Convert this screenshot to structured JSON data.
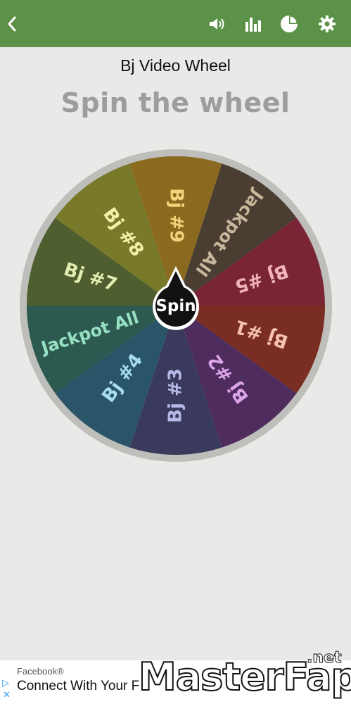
{
  "header": {
    "back_icon": "back-arrow-icon",
    "actions": [
      "sound-icon",
      "stats-icon",
      "pie-chart-icon",
      "settings-icon"
    ]
  },
  "title": "Bj Video Wheel",
  "subtitle": "Spin the wheel",
  "wheel": {
    "center_label": "Spin",
    "segments": [
      {
        "label": "Bj #9",
        "color": "#8a6a1e",
        "text_color": "#f3d27a"
      },
      {
        "label": "Jackpot All",
        "color": "#4a3e33",
        "text_color": "#c9b79c"
      },
      {
        "label": "Bj #5",
        "color": "#7a2536",
        "text_color": "#f0b3bb"
      },
      {
        "label": "Bj #1",
        "color": "#7a2d22",
        "text_color": "#f5c2b3"
      },
      {
        "label": "Bj #2",
        "color": "#4f2c5e",
        "text_color": "#dba5e8"
      },
      {
        "label": "Bj #3",
        "color": "#3a3a5c",
        "text_color": "#b6b8e6"
      },
      {
        "label": "Bj #4",
        "color": "#2a5468",
        "text_color": "#a6dbf0"
      },
      {
        "label": "Jackpot All",
        "color": "#2c5a50",
        "text_color": "#97e0c2"
      },
      {
        "label": "Bj #7",
        "color": "#4e5e2e",
        "text_color": "#e3ecb0"
      },
      {
        "label": "Bj #8",
        "color": "#787a2a",
        "text_color": "#f3f0a8"
      }
    ]
  },
  "ad": {
    "brand": "Facebook®",
    "text": "Connect With Your F"
  },
  "watermark": {
    "main": "MasterFap",
    "suffix": ".net"
  }
}
